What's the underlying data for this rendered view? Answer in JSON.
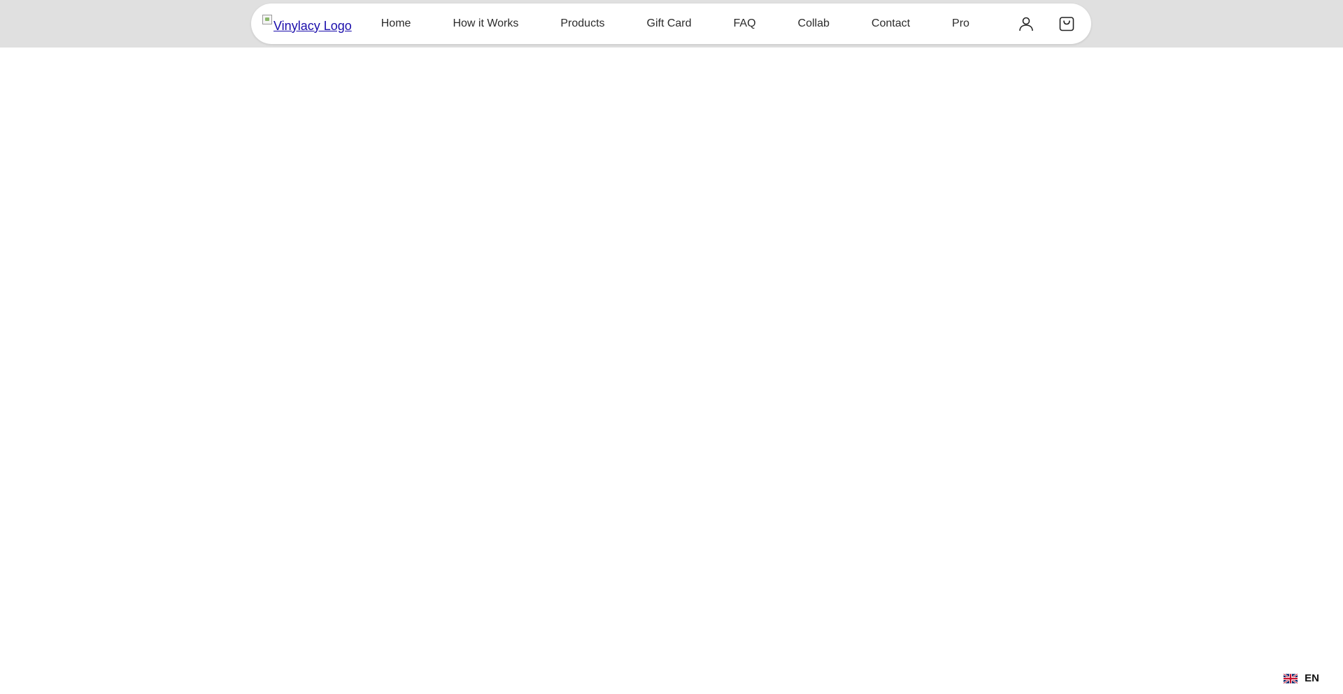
{
  "header": {
    "logo_alt": "Vinylacy Logo",
    "nav": [
      {
        "label": "Home"
      },
      {
        "label": "How it Works"
      },
      {
        "label": "Products"
      },
      {
        "label": "Gift Card"
      },
      {
        "label": "FAQ"
      },
      {
        "label": "Collab"
      },
      {
        "label": "Contact"
      },
      {
        "label": "Pro"
      }
    ],
    "icons": {
      "account": "user-icon",
      "cart": "shopping-bag-icon"
    }
  },
  "language": {
    "code": "EN",
    "flag": "uk-flag-icon"
  },
  "colors": {
    "header_band": "#e0e0e0",
    "nav_background": "#ffffff",
    "nav_text": "#2b2b2b",
    "logo_link": "#1a0dab"
  }
}
